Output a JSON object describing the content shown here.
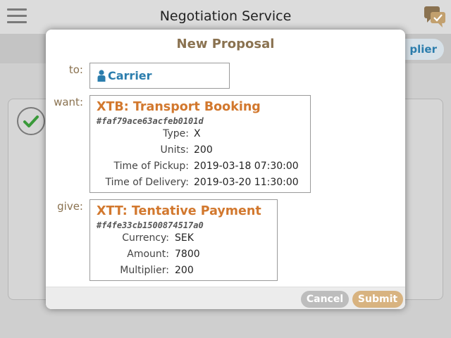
{
  "app": {
    "title": "Negotiation Service",
    "supplier_tab_label": "Supplier",
    "supplier_tab_visible": "plier"
  },
  "modal": {
    "title": "New Proposal",
    "to_label": "to:",
    "want_label": "want:",
    "give_label": "give:",
    "to": {
      "name": "Carrier",
      "icon": "person-icon"
    },
    "want": {
      "title": "XTB: Transport Booking",
      "id": "#faf79ace63acfeb0101d",
      "rows": [
        {
          "key": "Type:",
          "value": "X"
        },
        {
          "key": "Units:",
          "value": "200"
        },
        {
          "key": "Time of Pickup:",
          "value": "2019-03-18 07:30:00"
        },
        {
          "key": "Time of Delivery:",
          "value": "2019-03-20 11:30:00"
        }
      ]
    },
    "give": {
      "title": "XTT: Tentative Payment",
      "id": "#f4fe33cb1500874517a0",
      "rows": [
        {
          "key": "Currency:",
          "value": "SEK"
        },
        {
          "key": "Amount:",
          "value": "7800"
        },
        {
          "key": "Multiplier:",
          "value": "200"
        }
      ]
    },
    "cancel_label": "Cancel",
    "submit_label": "Submit"
  },
  "colors": {
    "accent_brown": "#8a7250",
    "contract_orange": "#d2782e",
    "link_blue": "#2b7dad",
    "submit_bg": "#d8b380",
    "cancel_bg": "#bdbdbd",
    "check_green": "#3a9a3a"
  }
}
